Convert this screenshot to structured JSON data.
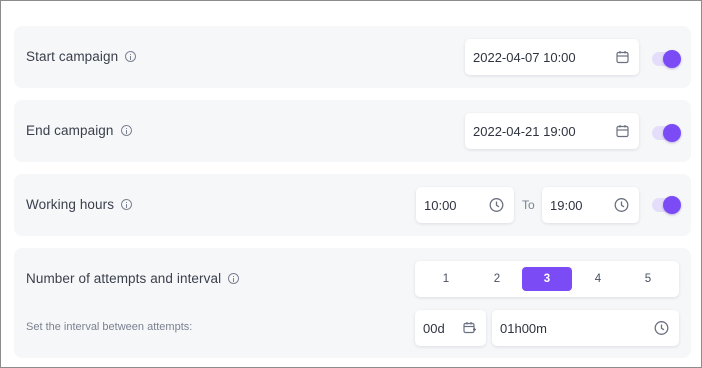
{
  "start_campaign": {
    "label": "Start campaign",
    "datetime": "2022-04-07 10:00",
    "enabled": true
  },
  "end_campaign": {
    "label": "End campaign",
    "datetime": "2022-04-21 19:00",
    "enabled": true
  },
  "working_hours": {
    "label": "Working hours",
    "from": "10:00",
    "to_label": "To",
    "to": "19:00",
    "enabled": true
  },
  "attempts": {
    "label": "Number of attempts and interval",
    "options": [
      "1",
      "2",
      "3",
      "4",
      "5"
    ],
    "selected": "3",
    "interval_label": "Set the interval between attempts:",
    "interval_days": "00d",
    "interval_time": "01h00m"
  },
  "colors": {
    "accent": "#7b4cf5",
    "card_bg": "#f6f7f9",
    "toggle_track": "#e4defa"
  },
  "icons": {
    "info": "info-icon",
    "calendar": "calendar-icon",
    "clock": "clock-icon",
    "calendar_add": "calendar-add-icon"
  }
}
